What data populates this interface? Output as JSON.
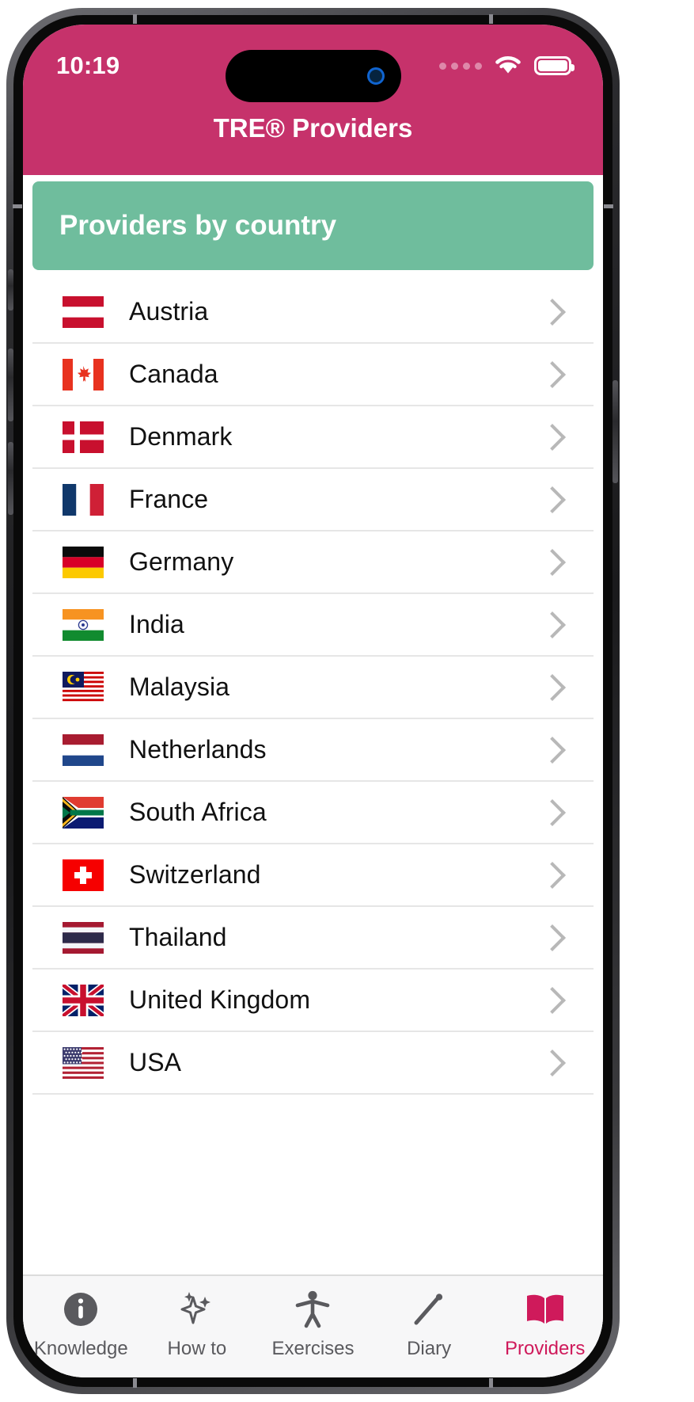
{
  "status_bar": {
    "time": "10:19",
    "wifi_icon": "wifi-icon",
    "battery_icon": "battery-icon",
    "signal_icon": "signal-dots-icon"
  },
  "header": {
    "title": "TRE® Providers",
    "background_color": "#c6326b"
  },
  "section": {
    "title": "Providers by country",
    "background_color": "#6fbd9d"
  },
  "countries": [
    {
      "name": "Austria",
      "flag": "flag-austria"
    },
    {
      "name": "Canada",
      "flag": "flag-canada"
    },
    {
      "name": "Denmark",
      "flag": "flag-denmark"
    },
    {
      "name": "France",
      "flag": "flag-france"
    },
    {
      "name": "Germany",
      "flag": "flag-germany"
    },
    {
      "name": "India",
      "flag": "flag-india"
    },
    {
      "name": "Malaysia",
      "flag": "flag-malaysia"
    },
    {
      "name": "Netherlands",
      "flag": "flag-netherlands"
    },
    {
      "name": "South Africa",
      "flag": "flag-south-africa"
    },
    {
      "name": "Switzerland",
      "flag": "flag-switzerland"
    },
    {
      "name": "Thailand",
      "flag": "flag-thailand"
    },
    {
      "name": "United Kingdom",
      "flag": "flag-united-kingdom"
    },
    {
      "name": "USA",
      "flag": "flag-usa"
    }
  ],
  "chevron_icon": "chevron-right-icon",
  "tabs": [
    {
      "label": "Knowledge",
      "icon": "info-circle-icon",
      "active": false
    },
    {
      "label": "How to",
      "icon": "sparkles-icon",
      "active": false
    },
    {
      "label": "Exercises",
      "icon": "person-icon",
      "active": false
    },
    {
      "label": "Diary",
      "icon": "pencil-icon",
      "active": false
    },
    {
      "label": "Providers",
      "icon": "book-icon",
      "active": true
    }
  ],
  "colors": {
    "accent_pink": "#cf1a5b",
    "header_pink": "#c6326b",
    "section_green": "#6fbd9d",
    "tab_inactive": "#5a5a5e"
  }
}
